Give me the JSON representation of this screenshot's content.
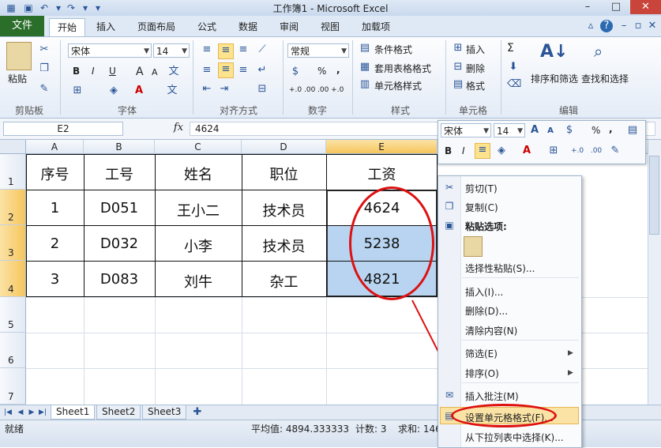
{
  "window": {
    "title": "工作簿1 - Microsoft Excel",
    "min_label": "–",
    "max_label": "□",
    "close_label": "✕"
  },
  "tabs": [
    "文件",
    "开始",
    "插入",
    "页面布局",
    "公式",
    "数据",
    "审阅",
    "视图",
    "加载项"
  ],
  "ribbon": {
    "clipboard": {
      "paste": "粘贴",
      "label": "剪贴板"
    },
    "font": {
      "name": "宋体",
      "size": "14",
      "label": "字体",
      "bold": "B",
      "italic": "I",
      "underline": "U",
      "grow": "A",
      "shrink": "A",
      "wen": "wén"
    },
    "alignment": {
      "label": "对齐方式"
    },
    "number": {
      "format": "常规",
      "percent": "%",
      "comma": ",",
      "label": "数字",
      "inc": "+.0 .00",
      "dec": ".00 +.0"
    },
    "styles": {
      "conditional": "条件格式",
      "table": "套用表格格式",
      "cell": "单元格样式",
      "label": "样式"
    },
    "cells": {
      "insert": "插入",
      "delete": "删除",
      "format": "格式",
      "label": "单元格"
    },
    "editing": {
      "sum": "Σ",
      "sort": "排序和筛选",
      "find": "查找和选择",
      "label": "编辑"
    }
  },
  "formula_bar": {
    "name": "E2",
    "fx": "fx",
    "value": "4624"
  },
  "columns": [
    "A",
    "B",
    "C",
    "D",
    "E"
  ],
  "rows": [
    "1",
    "2",
    "3",
    "4",
    "5",
    "6",
    "7"
  ],
  "table": {
    "headers": [
      "序号",
      "工号",
      "姓名",
      "职位",
      "工资"
    ],
    "data": [
      [
        "1",
        "D051",
        "王小二",
        "技术员",
        "4624"
      ],
      [
        "2",
        "D032",
        "小李",
        "技术员",
        "5238"
      ],
      [
        "3",
        "D083",
        "刘牛",
        "杂工",
        "4821"
      ]
    ]
  },
  "mini_toolbar": {
    "font": "宋体",
    "size": "14",
    "bold": "B",
    "italic": "I",
    "percent": "%",
    "comma": ","
  },
  "context_menu": {
    "cut": "剪切(T)",
    "copy": "复制(C)",
    "paste_options": "粘贴选项:",
    "paste_special": "选择性粘贴(S)...",
    "insert": "插入(I)...",
    "delete": "删除(D)...",
    "clear": "清除内容(N)",
    "filter": "筛选(E)",
    "sort": "排序(O)",
    "insert_comment": "插入批注(M)",
    "format_cells": "设置单元格格式(F)...",
    "pick_list": "从下拉列表中选择(K)..."
  },
  "sheets": [
    "Sheet1",
    "Sheet2",
    "Sheet3"
  ],
  "status": {
    "ready": "就绪",
    "average": "平均值: 4894.333333",
    "count": "计数: 3",
    "sum": "求和: 146"
  },
  "colors": {
    "file_tab": "#2a6e2a",
    "selection": "#b8d4f0",
    "annotation": "#dd1111"
  }
}
